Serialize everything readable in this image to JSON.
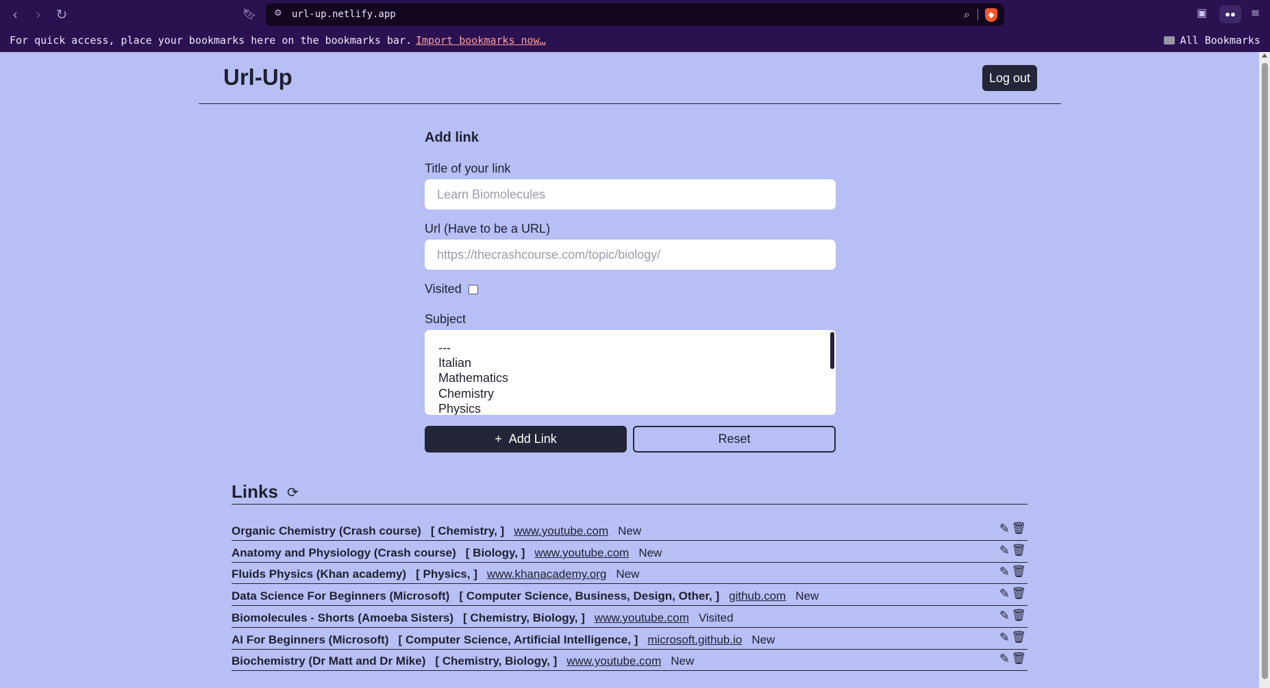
{
  "browser": {
    "url": "url-up.netlify.app",
    "bookmarks_prompt": "For quick access, place your bookmarks here on the bookmarks bar.",
    "import_link": "Import bookmarks now…",
    "all_bookmarks": "All Bookmarks"
  },
  "app": {
    "title": "Url-Up",
    "logout_label": "Log out"
  },
  "form": {
    "heading": "Add link",
    "title_label": "Title of your link",
    "title_placeholder": "Learn Biomolecules",
    "url_label": "Url (Have to be a URL)",
    "url_placeholder": "https://thecrashcourse.com/topic/biology/",
    "visited_label": "Visited",
    "visited_checked": false,
    "subject_label": "Subject",
    "subject_options": [
      "---",
      "Italian",
      "Mathematics",
      "Chemistry",
      "Physics"
    ],
    "add_button": "Add Link",
    "reset_button": "Reset"
  },
  "links": {
    "heading": "Links",
    "items": [
      {
        "title": "Organic Chemistry (Crash course)",
        "subjects": "[  Chemistry,  ]",
        "domain": "www.youtube.com",
        "status": "New"
      },
      {
        "title": "Anatomy and Physiology (Crash course)",
        "subjects": "[  Biology,  ]",
        "domain": "www.youtube.com",
        "status": "New"
      },
      {
        "title": "Fluids Physics (Khan academy)",
        "subjects": "[  Physics,  ]",
        "domain": "www.khanacademy.org",
        "status": "New"
      },
      {
        "title": "Data Science For Beginners (Microsoft)",
        "subjects": "[  Computer Science,  Business,  Design,  Other,  ]",
        "domain": "github.com",
        "status": "New"
      },
      {
        "title": "Biomolecules - Shorts (Amoeba Sisters)",
        "subjects": "[  Chemistry,  Biology,  ]",
        "domain": "www.youtube.com",
        "status": "Visited"
      },
      {
        "title": "AI For Beginners (Microsoft)",
        "subjects": "[  Computer Science,  Artificial Intelligence,  ]",
        "domain": "microsoft.github.io",
        "status": "New"
      },
      {
        "title": "Biochemistry (Dr Matt and Dr Mike)",
        "subjects": "[  Chemistry,  Biology,  ]",
        "domain": "www.youtube.com",
        "status": "New"
      }
    ]
  },
  "colors": {
    "page_bg": "#b8bff5",
    "chrome_bg": "#2a1250",
    "primary_dark": "#232638"
  }
}
